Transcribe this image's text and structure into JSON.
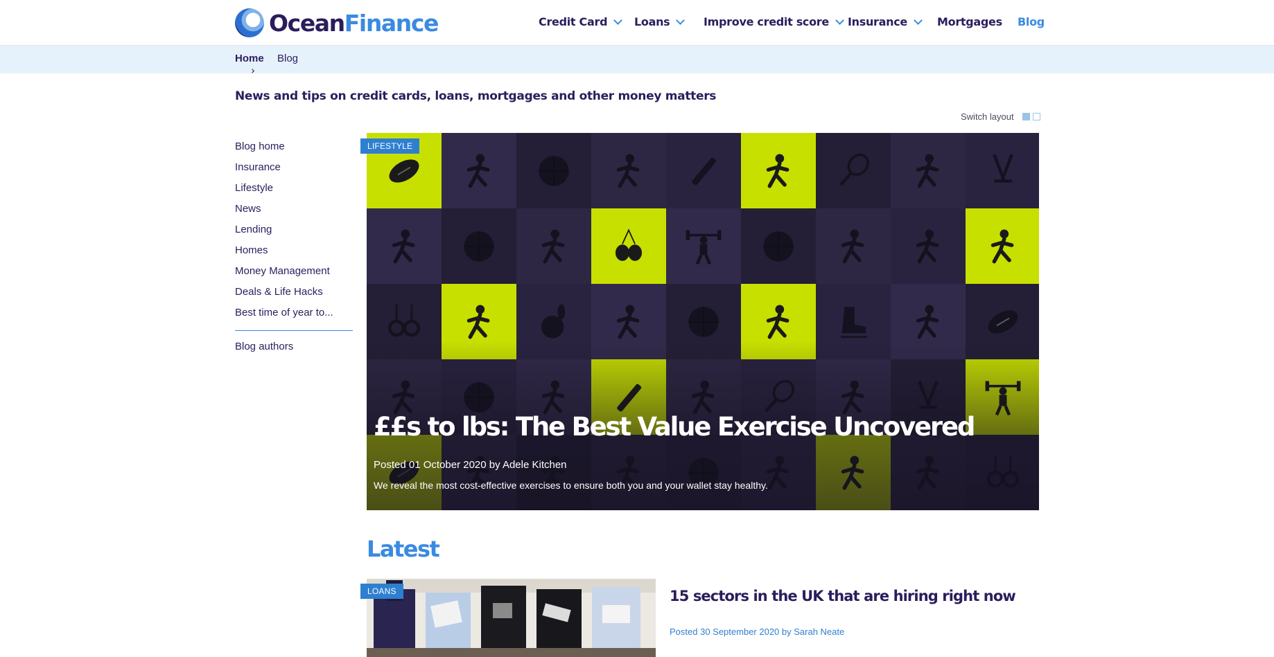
{
  "brand": {
    "word1": "Ocean",
    "word2": "Finance"
  },
  "nav": {
    "items": [
      {
        "label": "Credit Card",
        "dropdown": true
      },
      {
        "label": "Loans",
        "dropdown": true
      },
      {
        "label": "Improve credit score",
        "dropdown": true
      },
      {
        "label": "Insurance",
        "dropdown": true
      },
      {
        "label": "Mortgages",
        "dropdown": false
      },
      {
        "label": "Blog",
        "dropdown": false,
        "active": true
      }
    ]
  },
  "breadcrumb": {
    "home": "Home",
    "separator": "›",
    "current": "Blog"
  },
  "tagline": "News and tips on credit cards, loans, mortgages and other money matters",
  "switch_layout": {
    "label": "Switch layout"
  },
  "sidebar": {
    "items": [
      "Blog home",
      "Insurance",
      "Lifestyle",
      "News",
      "Lending",
      "Homes",
      "Money Management",
      "Deals & Life Hacks",
      "Best time of year to..."
    ],
    "authors_link": "Blog authors"
  },
  "featured": {
    "category": "LIFESTYLE",
    "title": "££s to lbs: The Best Value Exercise Uncovered",
    "meta": "Posted 01 October 2020 by Adele Kitchen",
    "description": "We reveal the most cost-effective exercises to ensure both you and your wallet stay healthy."
  },
  "latest": {
    "heading": "Latest",
    "articles": [
      {
        "category": "LOANS",
        "title": "15 sectors in the UK that are hiring right now",
        "meta": "Posted 30 September 2020 by Sarah Neate"
      }
    ]
  },
  "colors": {
    "brand_navy": "#2b1d5c",
    "brand_blue": "#3a8be0",
    "badge_blue": "#2f7fd1",
    "lime": "#c8e000",
    "tile_dark": "#2a2340",
    "breadcrumb_bg": "#e6f2fb"
  }
}
